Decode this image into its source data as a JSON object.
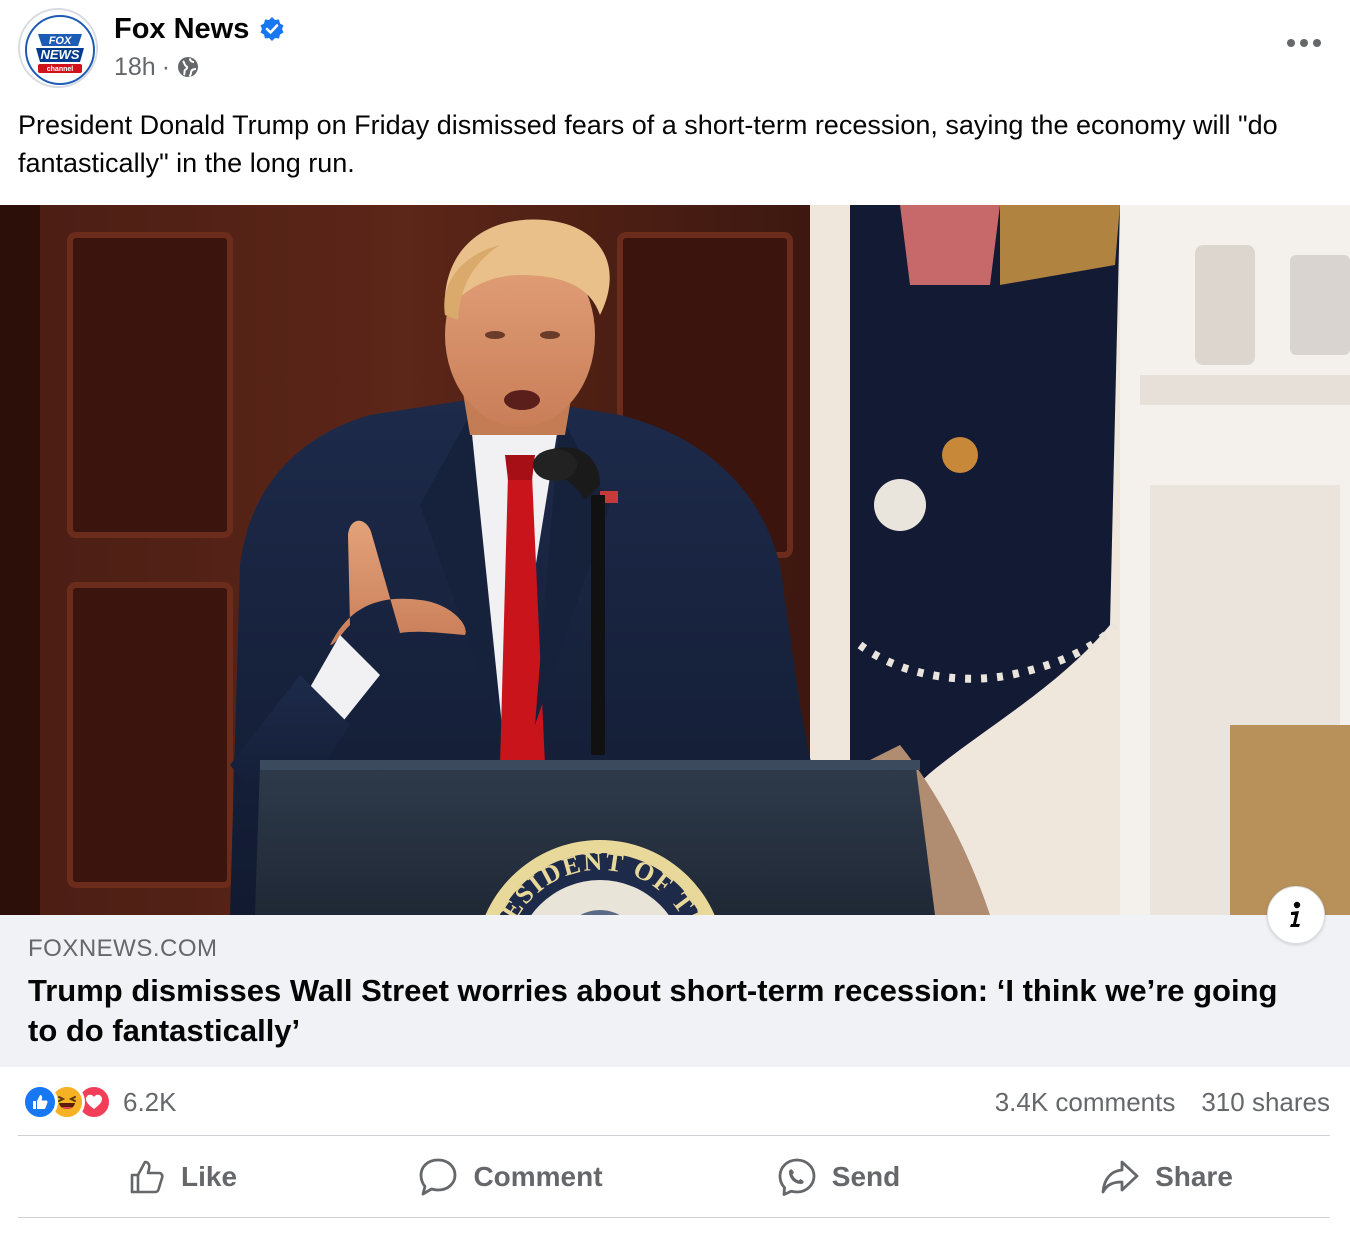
{
  "post": {
    "page_name": "Fox News",
    "time_ago": "18h",
    "time_separator": "·",
    "caption": "President Donald Trump on Friday dismissed fears of a short-term recession, saying the economy will \"do fantastically\" in the long run.",
    "avatar_text": {
      "line1": "FOX",
      "line2": "NEWS",
      "line3": "channel"
    }
  },
  "hero_image": {
    "alt": "Trump speaking at a podium",
    "seal_text": "PRESIDENT OF THE UNITED"
  },
  "link": {
    "domain": "FOXNEWS.COM",
    "headline": "Trump dismisses Wall Street worries about short-term recession: ‘I think we’re going to do fantastically’"
  },
  "stats": {
    "reaction_count": "6.2K",
    "comments": "3.4K comments",
    "shares": "310 shares"
  },
  "actions": {
    "like": "Like",
    "comment": "Comment",
    "send": "Send",
    "share": "Share"
  },
  "colors": {
    "accent_blue": "#1877f2",
    "love_red": "#f33e58",
    "haha_yellow": "#f7b125",
    "secondary_text": "#65676b",
    "card_bg": "#f0f2f5",
    "fox_blue": "#003b8f",
    "fox_red": "#d0121b"
  },
  "icons": {
    "verified": "verified-badge-icon",
    "privacy": "globe-icon",
    "more": "more-options-icon",
    "info": "info-icon",
    "like": "thumbs-up-icon",
    "comment": "comment-bubble-icon",
    "send": "messenger-icon",
    "share": "share-arrow-icon"
  }
}
